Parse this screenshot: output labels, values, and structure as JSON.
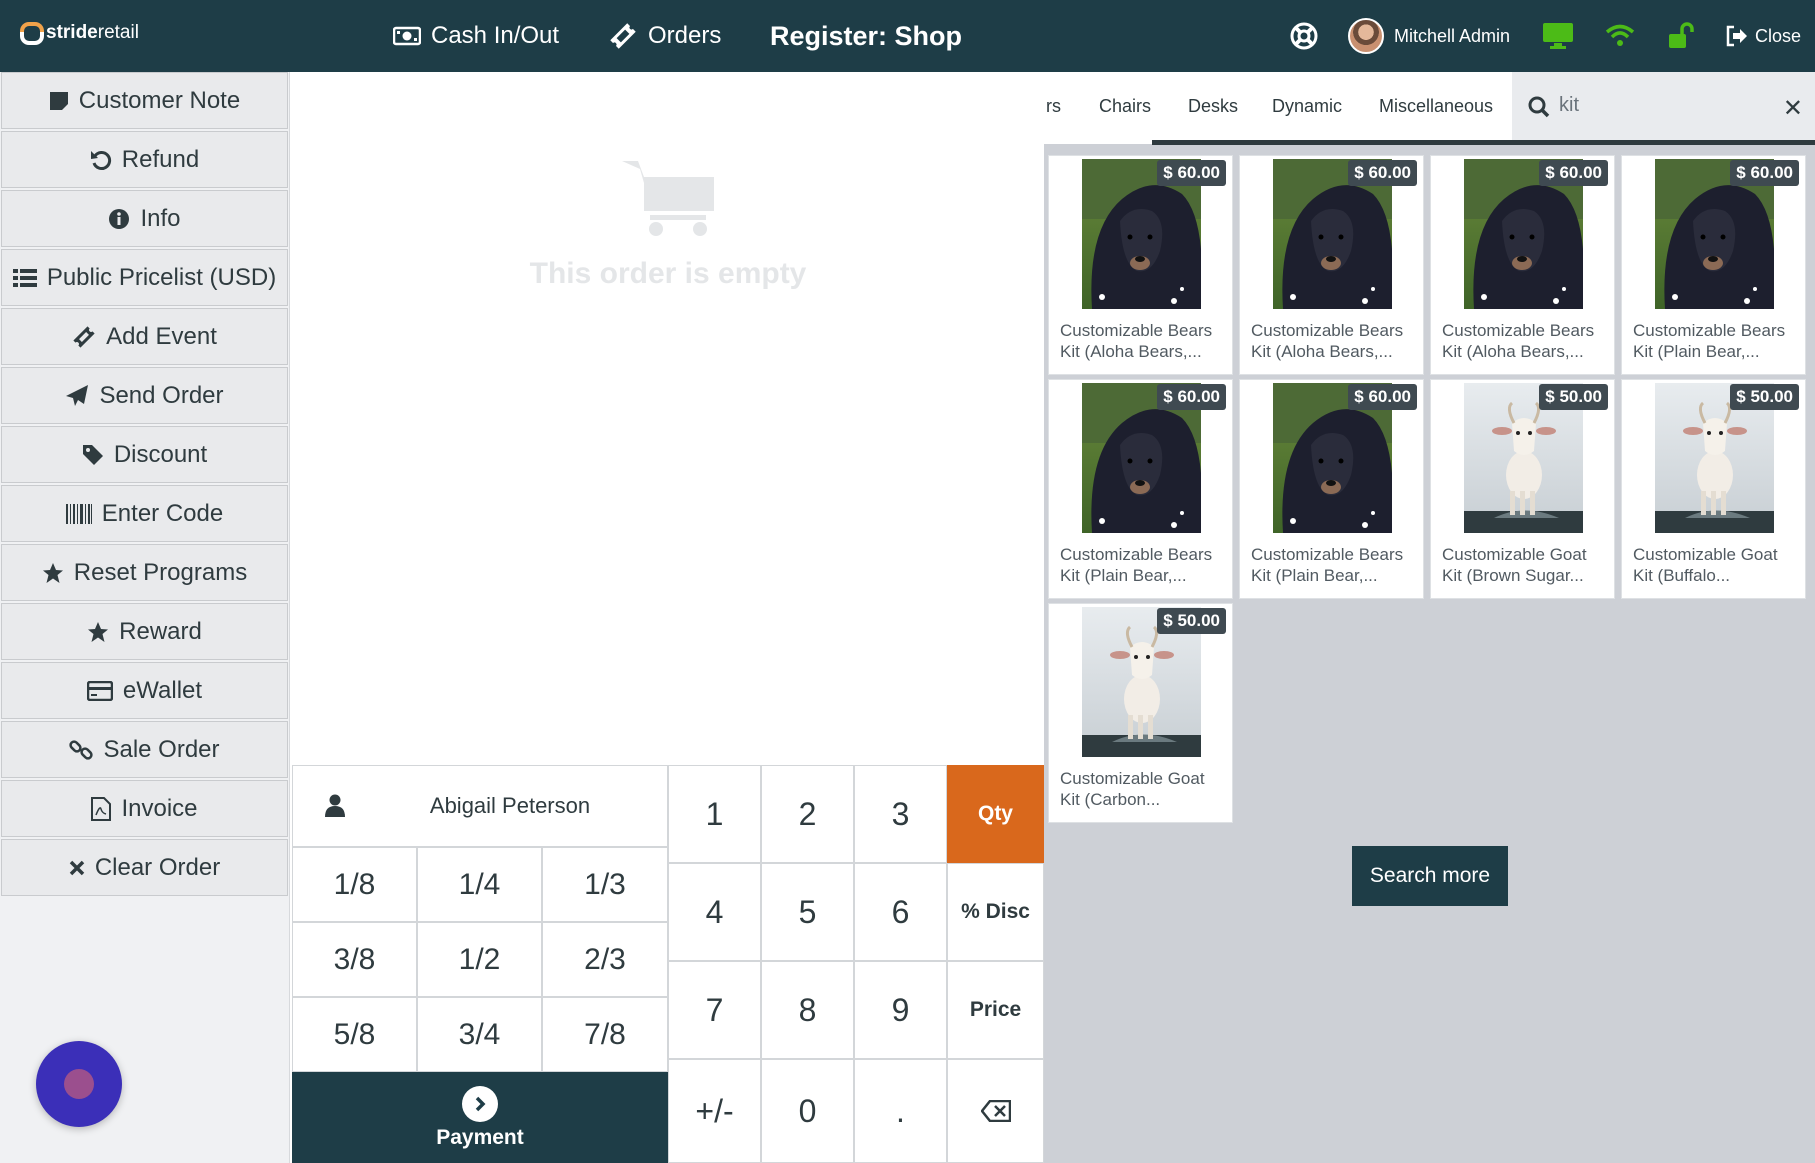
{
  "topbar": {
    "logo_text_bold": "stride",
    "logo_text": "retail",
    "cash_label": "Cash In/Out",
    "orders_label": "Orders",
    "register_title": "Register: Shop",
    "user_name": "Mitchell Admin",
    "close_label": "Close",
    "accent_green": "#4cbb17"
  },
  "controls": [
    {
      "label": "Customer Note",
      "icon": "sticky-note-icon"
    },
    {
      "label": "Refund",
      "icon": "undo-icon"
    },
    {
      "label": "Info",
      "icon": "info-circle-icon"
    },
    {
      "label": "Public Pricelist (USD)",
      "icon": "list-icon"
    },
    {
      "label": "Add Event",
      "icon": "ticket-icon"
    },
    {
      "label": "Send Order",
      "icon": "paper-plane-icon"
    },
    {
      "label": "Discount",
      "icon": "tag-icon"
    },
    {
      "label": "Enter Code",
      "icon": "barcode-icon"
    },
    {
      "label": "Reset Programs",
      "icon": "star-icon"
    },
    {
      "label": "Reward",
      "icon": "star-icon"
    },
    {
      "label": "eWallet",
      "icon": "credit-card-icon"
    },
    {
      "label": "Sale Order",
      "icon": "link-icon"
    },
    {
      "label": "Invoice",
      "icon": "file-pdf-icon"
    },
    {
      "label": "Clear Order",
      "icon": "x-icon"
    }
  ],
  "order": {
    "empty_text": "This order is empty"
  },
  "pad": {
    "customer_name": "Abigail Peterson",
    "fractions": [
      "1/8",
      "1/4",
      "1/3",
      "3/8",
      "1/2",
      "2/3",
      "5/8",
      "3/4",
      "7/8"
    ],
    "payment_label": "Payment",
    "keys": [
      "1",
      "2",
      "3",
      "Qty",
      "4",
      "5",
      "6",
      "% Disc",
      "7",
      "8",
      "9",
      "Price",
      "+/-",
      "0",
      ".",
      "backspace"
    ],
    "active_mode": "Qty",
    "active_color": "#d9681c"
  },
  "products": {
    "categories": [
      "rs",
      "Chairs",
      "Desks",
      "Dynamic",
      "Miscellaneous"
    ],
    "search_value": "kit",
    "items": [
      {
        "price": "$ 60.00",
        "name": "Customizable Bears Kit (Aloha Bears,...",
        "image": "bear"
      },
      {
        "price": "$ 60.00",
        "name": "Customizable Bears Kit (Aloha Bears,...",
        "image": "bear"
      },
      {
        "price": "$ 60.00",
        "name": "Customizable Bears Kit (Aloha Bears,...",
        "image": "bear"
      },
      {
        "price": "$ 60.00",
        "name": "Customizable Bears Kit (Plain Bear,...",
        "image": "bear"
      },
      {
        "price": "$ 60.00",
        "name": "Customizable Bears Kit (Plain Bear,...",
        "image": "bear"
      },
      {
        "price": "$ 60.00",
        "name": "Customizable Bears Kit (Plain Bear,...",
        "image": "bear"
      },
      {
        "price": "$ 50.00",
        "name": "Customizable Goat Kit (Brown Sugar...",
        "image": "goat"
      },
      {
        "price": "$ 50.00",
        "name": "Customizable Goat Kit (Buffalo...",
        "image": "goat"
      },
      {
        "price": "$ 50.00",
        "name": "Customizable Goat Kit (Carbon...",
        "image": "goat"
      }
    ],
    "search_more_label": "Search more"
  }
}
